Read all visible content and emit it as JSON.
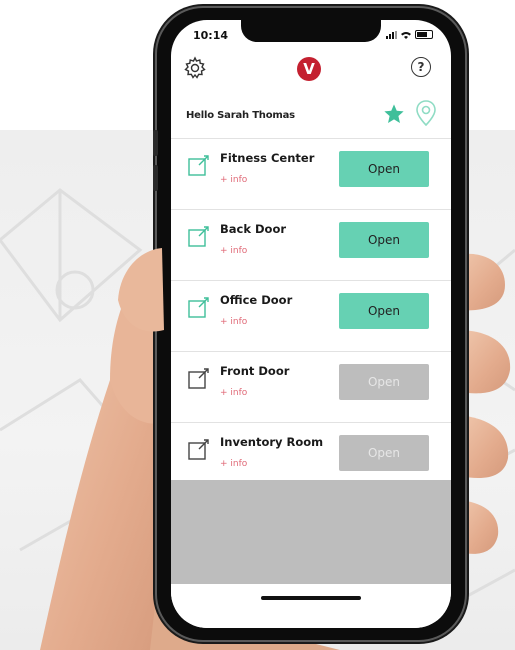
{
  "status_bar": {
    "time": "10:14"
  },
  "header": {
    "logo_letter": "V",
    "help_label": "?",
    "greeting": "Hello Sarah Thomas"
  },
  "colors": {
    "accent": "#66d1b3",
    "brand": "#c42030",
    "info_link": "#e06a78",
    "disabled": "#bdbdbd"
  },
  "doors": [
    {
      "name": "Fitness Center",
      "info": "+ info",
      "button": "Open",
      "enabled": true
    },
    {
      "name": "Back Door",
      "info": "+ info",
      "button": "Open",
      "enabled": true
    },
    {
      "name": "Office Door",
      "info": "+ info",
      "button": "Open",
      "enabled": true
    },
    {
      "name": "Front Door",
      "info": "+ info",
      "button": "Open",
      "enabled": false
    },
    {
      "name": "Inventory Room",
      "info": "+ info",
      "button": "Open",
      "enabled": false
    }
  ],
  "icons": {
    "settings": "gear-icon",
    "logo": "brand-logo-icon",
    "help": "help-icon",
    "favorites": "star-icon",
    "location": "location-pin-icon",
    "door": "door-lock-icon"
  }
}
